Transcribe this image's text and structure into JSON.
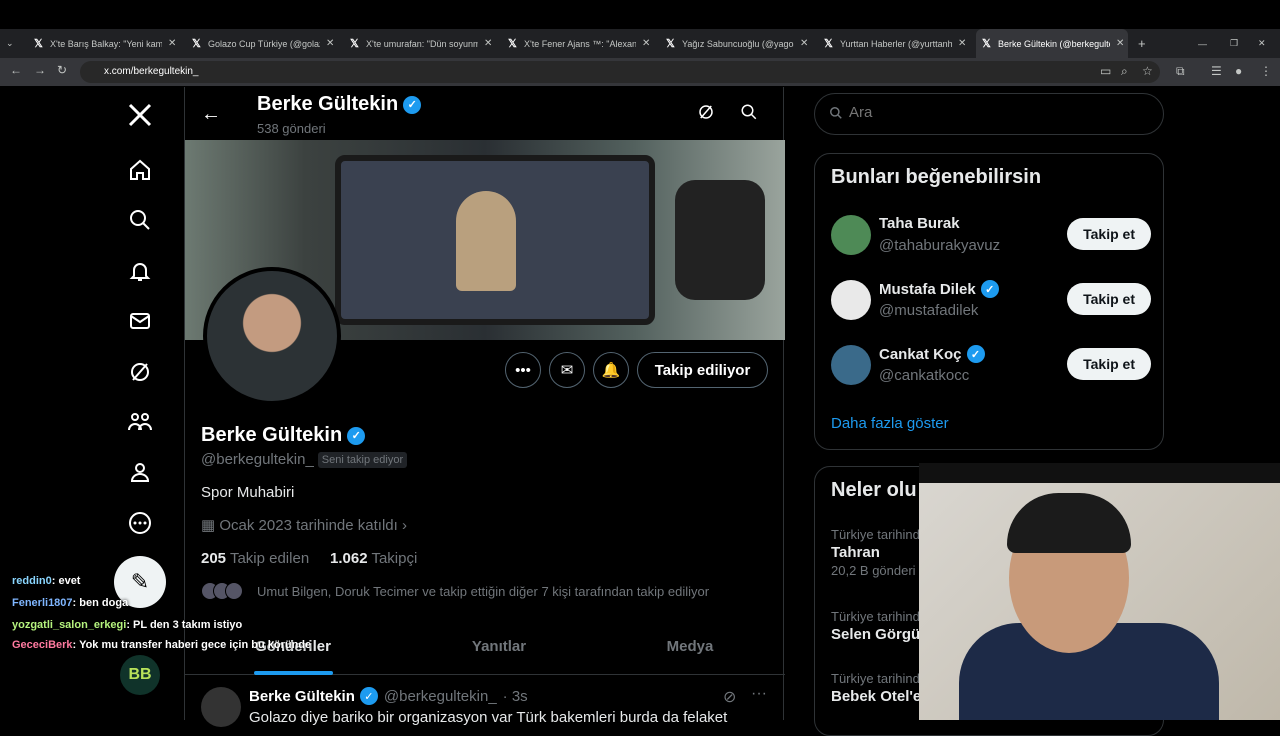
{
  "browser": {
    "tabs": [
      {
        "label": "X'te Barış Balkay: \"Yeni kamera"
      },
      {
        "label": "Golazo Cup Türkiye (@golazoc"
      },
      {
        "label": "X'te umurafan: \"Dün soyunma"
      },
      {
        "label": "X'te Fener Ajans ™: \"Alexander"
      },
      {
        "label": "Yağız Sabuncuoğlu (@yagosab"
      },
      {
        "label": "Yurttan Haberler (@yurttanhab"
      },
      {
        "label": "Berke Gültekin (@berkegultekin"
      }
    ],
    "url": "x.com/berkegultekin_"
  },
  "header": {
    "name": "Berke Gültekin",
    "post_count": "538 gönderi"
  },
  "profile": {
    "name": "Berke Gültekin",
    "handle": "@berkegultekin_",
    "follows_you": "Seni takip ediyor",
    "bio": "Spor Muhabiri",
    "joined": "Ocak 2023 tarihinde katıldı",
    "following_count": "205",
    "following_label": "Takip edilen",
    "followers_count": "1.062",
    "followers_label": "Takipçi",
    "followed_by": "Umut Bilgen, Doruk Tecimer ve takip ettiğin diğer 7 kişi tarafından takip ediliyor",
    "follow_button": "Takip ediliyor"
  },
  "profile_tabs": [
    "Gönderiler",
    "Yanıtlar",
    "Medya"
  ],
  "tweet": {
    "name": "Berke Gültekin",
    "handle": "@berkegultekin_",
    "time": "· 3s",
    "text": "Golazo diye bariko bir organizasyon var Türk bakemleri burda da felaket"
  },
  "search": {
    "placeholder": "Ara"
  },
  "suggestions": {
    "title": "Bunları beğenebilirsin",
    "items": [
      {
        "name": "Taha Burak",
        "handle": "@tahaburakyavuz",
        "button": "Takip et"
      },
      {
        "name": "Mustafa Dilek",
        "handle": "@mustafadilek",
        "button": "Takip et"
      },
      {
        "name": "Cankat Koç",
        "handle": "@cankatkocc",
        "button": "Takip et"
      }
    ],
    "more": "Daha fazla göster"
  },
  "trends": {
    "title": "Neler olu",
    "items": [
      {
        "context": "Türkiye tarihinde",
        "topic": "Tahran",
        "posts": "20,2 B gönderi"
      },
      {
        "context": "Türkiye tarihinde",
        "topic": "Selen Görgü",
        "posts": ""
      },
      {
        "context": "Türkiye tarihinde",
        "topic": "Bebek Otel'e",
        "posts": ""
      }
    ]
  },
  "chat": [
    {
      "user": "reddin0",
      "msg": ": evet"
    },
    {
      "user": "Fenerli1807",
      "msg": ": ben doga"
    },
    {
      "user": "yozgatli_salon_erkegi",
      "msg": ": PL den 3 takım istiyo"
    },
    {
      "user": "GececiBerk",
      "msg": ": Yok mu transfer haberi gece için bu köründe"
    }
  ],
  "colors": {
    "accent": "#1d9bf0",
    "background": "#000000",
    "muted": "#71767b"
  }
}
